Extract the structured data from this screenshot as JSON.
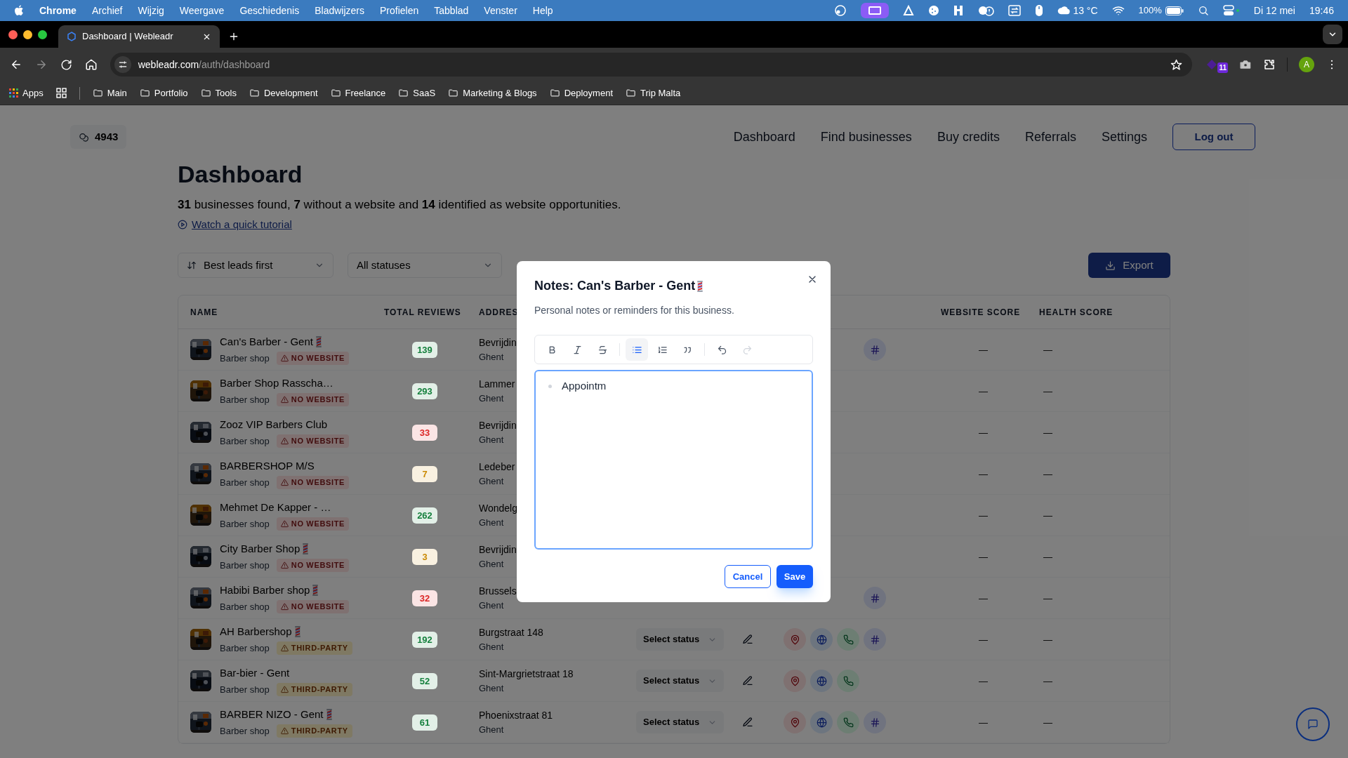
{
  "menu_bar": {
    "app": "Chrome",
    "items": [
      "Archief",
      "Wijzig",
      "Weergave",
      "Geschiedenis",
      "Bladwijzers",
      "Profielen",
      "Tabblad",
      "Venster",
      "Help"
    ],
    "weather": "13 °C",
    "battery": "100%",
    "date": "Di 12 mei",
    "time": "19:46"
  },
  "browser": {
    "tab": {
      "title": "Dashboard | Webleadr"
    },
    "url": {
      "host": "webleadr.com",
      "path": "/auth/dashboard"
    },
    "extension_badge": "11",
    "profile": "A",
    "bookmarks": [
      {
        "kind": "apps",
        "label": "Apps"
      },
      {
        "kind": "grid"
      },
      {
        "kind": "folder",
        "label": "Main"
      },
      {
        "kind": "folder",
        "label": "Portfolio"
      },
      {
        "kind": "folder",
        "label": "Tools"
      },
      {
        "kind": "folder",
        "label": "Development"
      },
      {
        "kind": "folder",
        "label": "Freelance"
      },
      {
        "kind": "folder",
        "label": "SaaS"
      },
      {
        "kind": "folder",
        "label": "Marketing & Blogs"
      },
      {
        "kind": "folder",
        "label": "Deployment"
      },
      {
        "kind": "folder",
        "label": "Trip Malta"
      }
    ]
  },
  "header": {
    "credits": "4943",
    "nav": [
      "Dashboard",
      "Find businesses",
      "Buy credits",
      "Referrals",
      "Settings"
    ],
    "logout": "Log out"
  },
  "page": {
    "title": "Dashboard",
    "summary": "**31** businesses found, **7** without a website and **14** identified as website opportunities.",
    "tutorial_link": "Watch a quick tutorial",
    "sort": "Best leads first",
    "status_filter": "All statuses",
    "export": "Export"
  },
  "table": {
    "columns": [
      "NAME",
      "TOTAL REVIEWS",
      "ADDRES",
      "WEBSITE SCORE",
      "HEALTH SCORE"
    ],
    "rows": [
      {
        "name": "Can's Barber - Gent",
        "pole": true,
        "category": "Barber shop",
        "badge": {
          "kind": "no_website",
          "label": "NO WEBSITE"
        },
        "reviews": "139",
        "color": "#15803d",
        "address": "Bevrijdin",
        "city": "Ghent",
        "actions": [
          {
            "kind": "tag"
          }
        ],
        "website_score": "—",
        "health_score": "—"
      },
      {
        "name": "Barber Shop Rasscha…",
        "pole": false,
        "category": "Barber shop",
        "badge": {
          "kind": "no_website",
          "label": "NO WEBSITE"
        },
        "reviews": "293",
        "color": "#15803d",
        "address": "Lammer",
        "city": "Ghent",
        "website_score": "—",
        "health_score": "—"
      },
      {
        "name": "Zooz VIP Barbers Club",
        "pole": false,
        "category": "Barber shop",
        "badge": {
          "kind": "no_website",
          "label": "NO WEBSITE"
        },
        "reviews": "33",
        "color": "#dc2626",
        "address": "Bevrijdin",
        "city": "Ghent",
        "website_score": "—",
        "health_score": "—"
      },
      {
        "name": "BARBERSHOP M/S",
        "pole": false,
        "category": "Barber shop",
        "badge": {
          "kind": "no_website",
          "label": "NO WEBSITE"
        },
        "reviews": "7",
        "color": "#ca8a04",
        "address": "Ledeber",
        "city": "Ghent",
        "website_score": "—",
        "health_score": "—"
      },
      {
        "name": "Mehmet De Kapper - …",
        "pole": false,
        "category": "Barber shop",
        "badge": {
          "kind": "no_website",
          "label": "NO WEBSITE"
        },
        "reviews": "262",
        "color": "#15803d",
        "address": "Wondelg",
        "city": "Ghent",
        "website_score": "—",
        "health_score": "—"
      },
      {
        "name": "City Barber Shop",
        "pole": true,
        "category": "Barber shop",
        "badge": {
          "kind": "no_website",
          "label": "NO WEBSITE"
        },
        "reviews": "3",
        "color": "#ca8a04",
        "address": "Bevrijdin",
        "city": "Ghent",
        "website_score": "—",
        "health_score": "—"
      },
      {
        "name": "Habibi Barber shop",
        "pole": true,
        "category": "Barber shop",
        "badge": {
          "kind": "no_website",
          "label": "NO WEBSITE"
        },
        "reviews": "32",
        "color": "#dc2626",
        "address": "Brussels",
        "city": "Ghent",
        "actions": [
          {
            "kind": "tag"
          }
        ],
        "website_score": "—",
        "health_score": "—"
      },
      {
        "name": "AH Barbershop",
        "pole": true,
        "category": "Barber shop",
        "badge": {
          "kind": "third_party",
          "label": "THIRD-PARTY"
        },
        "reviews": "192",
        "color": "#15803d",
        "address": "Burgstraat 148",
        "city": "Ghent",
        "status": "Select status",
        "notes_button": true,
        "actions": [
          {
            "kind": "map"
          },
          {
            "kind": "website"
          },
          {
            "kind": "phone"
          },
          {
            "kind": "tag"
          }
        ],
        "website_score": "—",
        "health_score": "—"
      },
      {
        "name": "Bar-bier - Gent",
        "pole": false,
        "category": "Barber shop",
        "badge": {
          "kind": "third_party",
          "label": "THIRD-PARTY"
        },
        "reviews": "52",
        "color": "#15803d",
        "address": "Sint-Margrietstraat 18",
        "city": "Ghent",
        "status": "Select status",
        "notes_button": true,
        "actions": [
          {
            "kind": "map"
          },
          {
            "kind": "website"
          },
          {
            "kind": "phone"
          }
        ],
        "website_score": "—",
        "health_score": "—"
      },
      {
        "name": "BARBER NIZO - Gent",
        "pole": true,
        "category": "Barber shop",
        "badge": {
          "kind": "third_party",
          "label": "THIRD-PARTY"
        },
        "reviews": "61",
        "color": "#15803d",
        "address": "Phoenixstraat 81",
        "city": "Ghent",
        "status": "Select status",
        "notes_button": true,
        "actions": [
          {
            "kind": "map"
          },
          {
            "kind": "website"
          },
          {
            "kind": "phone"
          },
          {
            "kind": "tag"
          }
        ],
        "website_score": "—",
        "health_score": "—"
      }
    ]
  },
  "modal": {
    "title": "Notes: Can's Barber - Gent",
    "title_pole": true,
    "subtitle": "Personal notes or reminders for this business.",
    "toolbar": [
      {
        "kind": "bold",
        "active": false,
        "disabled": false
      },
      {
        "kind": "italic",
        "active": false,
        "disabled": false
      },
      {
        "kind": "strike",
        "active": false,
        "disabled": false
      },
      {
        "kind": "separator"
      },
      {
        "kind": "bullet_list",
        "active": true,
        "disabled": false
      },
      {
        "kind": "ordered_list",
        "active": false,
        "disabled": false
      },
      {
        "kind": "quote",
        "active": false,
        "disabled": false
      },
      {
        "kind": "separator"
      },
      {
        "kind": "undo",
        "active": false,
        "disabled": false
      },
      {
        "kind": "redo",
        "active": false,
        "disabled": true
      }
    ],
    "bullets": [
      "Appointm"
    ],
    "cancel": "Cancel",
    "save": "Save"
  }
}
